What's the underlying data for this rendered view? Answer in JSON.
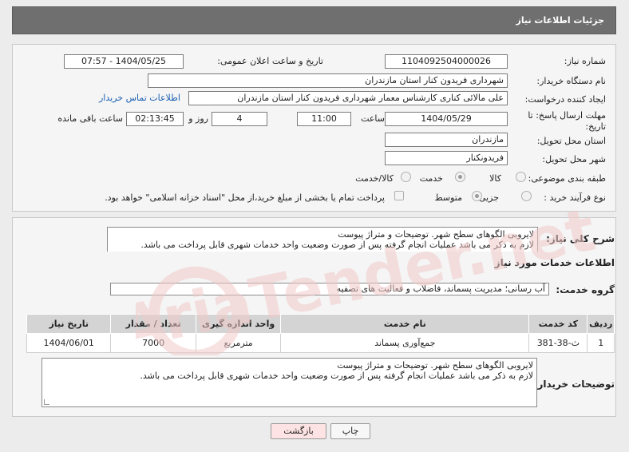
{
  "header": {
    "title": "جزئیات اطلاعات نیاز"
  },
  "form": {
    "need_number_label": "شماره نیاز:",
    "need_number": "1104092504000026",
    "announce_label": "تاریخ و ساعت اعلان عمومی:",
    "announce_value": "1404/05/25 - 07:57",
    "buyer_org_label": "نام دستگاه خریدار:",
    "buyer_org": "شهرداری فریدون کنار استان مازندران",
    "requester_label": "ایجاد کننده درخواست:",
    "requester": "علی مالائی کناری کارشناس معمار شهرداری فریدون کنار استان مازندران",
    "contact_link": "اطلاعات تماس خریدار",
    "deadline_label_1": "مهلت ارسال پاسخ: تا",
    "deadline_label_2": "تاریخ:",
    "deadline_date": "1404/05/29",
    "time_label": "ساعت",
    "deadline_time": "11:00",
    "days_value": "4",
    "days_label": "روز و",
    "remaining_time": "02:13:45",
    "remaining_label": "ساعت باقی مانده",
    "province_label": "استان محل تحویل:",
    "province": "مازندران",
    "city_label": "شهر محل تحویل:",
    "city": "فریدونکنار",
    "category_label": "طبقه بندی موضوعی:",
    "category_options": [
      "کالا",
      "خدمت",
      "کالا/خدمت"
    ],
    "category_selected": "خدمت",
    "process_label": "نوع فرآیند خرید :",
    "process_options": [
      "جزیی",
      "متوسط"
    ],
    "process_selected": "متوسط",
    "payment_note": "پرداخت تمام یا بخشی از مبلغ خرید،از محل \"اسناد خزانه اسلامی\" خواهد بود."
  },
  "summary": {
    "label": "شرح کلی نیاز:",
    "line1": "لایروبی الگوهای سطح شهر. توضیحات و متراژ پیوست",
    "line2": "لازم به ذکر می باشد عملیات انجام گرفته پس از صورت وضعیت واحد خدمات شهری قابل پرداخت می باشد."
  },
  "services": {
    "section_title": "اطلاعات خدمات مورد نیاز",
    "group_label": "گروه خدمت:",
    "group_value": "آب رسانی؛ مدیریت پسماند، فاضلاب و فعالیت های تصفیه",
    "columns": [
      "ردیف",
      "کد خدمت",
      "نام خدمت",
      "واحد اندازه گیری",
      "تعداد / مقدار",
      "تاریخ نیاز"
    ],
    "rows": [
      [
        "1",
        "ث-38-381",
        "جمع‌آوری پسماند",
        "مترمربع",
        "7000",
        "1404/06/01"
      ]
    ]
  },
  "buyer_notes": {
    "label": "توضیحات خریدار:",
    "line1": "لایروبی الگوهای سطح شهر. توضیحات و متراژ پیوست",
    "line2": "لازم به ذکر می باشد عملیات انجام گرفته پس از صورت وضعیت واحد خدمات شهری قابل پرداخت می باشد."
  },
  "buttons": {
    "print": "چاپ",
    "back": "بازگشت"
  },
  "watermark": "AriaTender.net",
  "colors": {
    "header_bg": "#6f6f6f",
    "link": "#1a5fb4",
    "back_button_bg": "#fde3e3",
    "watermark": "#f1c9c9"
  }
}
